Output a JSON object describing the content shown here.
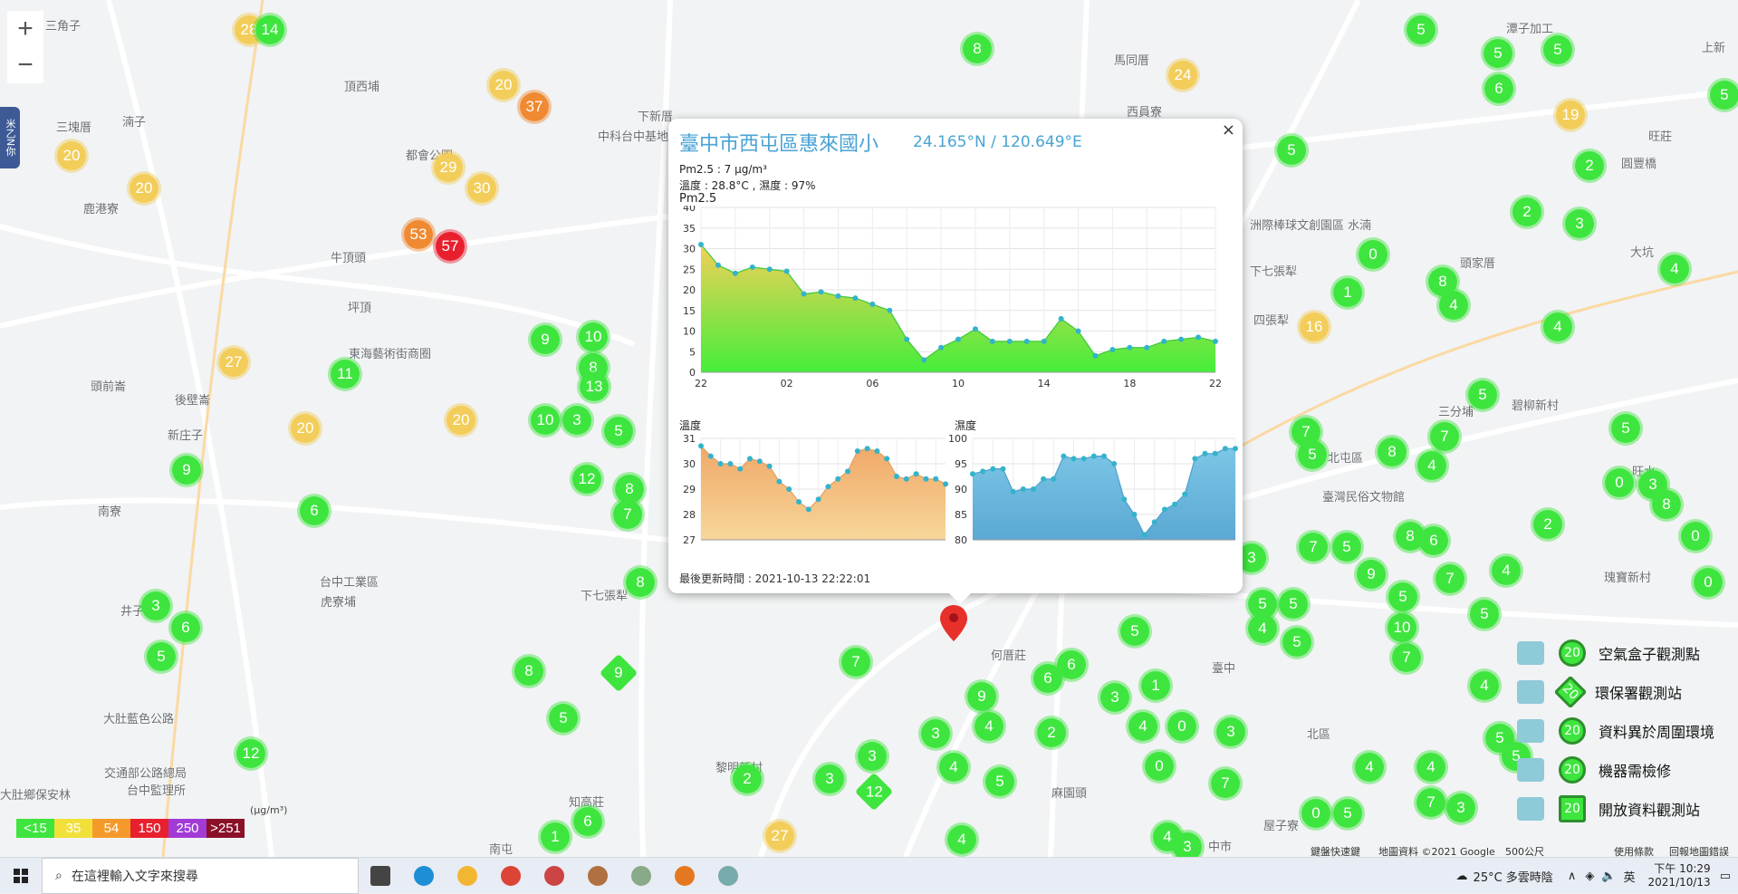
{
  "map": {
    "zoom_in": "+",
    "zoom_out": "−",
    "side_tab": "米乙N你",
    "place_labels": [
      {
        "text": "三角子",
        "x": 50,
        "y": 18
      },
      {
        "text": "湳子",
        "x": 135,
        "y": 124
      },
      {
        "text": "三塊厝",
        "x": 62,
        "y": 130
      },
      {
        "text": "鹿港寮",
        "x": 92,
        "y": 220
      },
      {
        "text": "頂西埔",
        "x": 380,
        "y": 85
      },
      {
        "text": "都會公園",
        "x": 448,
        "y": 161
      },
      {
        "text": "牛頂頭",
        "x": 365,
        "y": 274
      },
      {
        "text": "坪頂",
        "x": 384,
        "y": 329
      },
      {
        "text": "東海藝術街商圈",
        "x": 385,
        "y": 380
      },
      {
        "text": "頭前崙",
        "x": 100,
        "y": 416
      },
      {
        "text": "後壁崙",
        "x": 193,
        "y": 431
      },
      {
        "text": "新庄子",
        "x": 185,
        "y": 470
      },
      {
        "text": "南寮",
        "x": 108,
        "y": 554
      },
      {
        "text": "井子頭",
        "x": 133,
        "y": 664
      },
      {
        "text": "台中工業區",
        "x": 353,
        "y": 632
      },
      {
        "text": "虎寮埔",
        "x": 354,
        "y": 654
      },
      {
        "text": "大肚藍色公路",
        "x": 114,
        "y": 783
      },
      {
        "text": "交通部公路總局",
        "x": 115,
        "y": 843
      },
      {
        "text": "台中監理所",
        "x": 140,
        "y": 862
      },
      {
        "text": "大肚鄉保安林",
        "x": 0,
        "y": 867
      },
      {
        "text": "南屯",
        "x": 540,
        "y": 927
      },
      {
        "text": "知高莊",
        "x": 628,
        "y": 875
      },
      {
        "text": "下七張犁",
        "x": 641,
        "y": 647
      },
      {
        "text": "黎明新村",
        "x": 790,
        "y": 837
      },
      {
        "text": "何厝莊",
        "x": 1094,
        "y": 713
      },
      {
        "text": "麻園頭",
        "x": 1161,
        "y": 865
      },
      {
        "text": "臺中",
        "x": 1338,
        "y": 727
      },
      {
        "text": "北區",
        "x": 1443,
        "y": 800
      },
      {
        "text": "中市",
        "x": 1334,
        "y": 924
      },
      {
        "text": "屋子寮",
        "x": 1395,
        "y": 901
      },
      {
        "text": "洲際棒球文創園區 水湳",
        "x": 1380,
        "y": 238
      },
      {
        "text": "下七張犁",
        "x": 1380,
        "y": 289
      },
      {
        "text": "四張犁",
        "x": 1384,
        "y": 343
      },
      {
        "text": "北屯區",
        "x": 1466,
        "y": 495
      },
      {
        "text": "三分埔",
        "x": 1588,
        "y": 444
      },
      {
        "text": "臺灣民俗文物館",
        "x": 1460,
        "y": 538
      },
      {
        "text": "頭家厝",
        "x": 1612,
        "y": 280
      },
      {
        "text": "碧柳新村",
        "x": 1669,
        "y": 437
      },
      {
        "text": "大坑",
        "x": 1800,
        "y": 268
      },
      {
        "text": "旺水",
        "x": 1802,
        "y": 510
      },
      {
        "text": "瑰寶新村",
        "x": 1771,
        "y": 627
      },
      {
        "text": "上新",
        "x": 1879,
        "y": 42
      },
      {
        "text": "馬同厝",
        "x": 1230,
        "y": 56
      },
      {
        "text": "西員寮",
        "x": 1244,
        "y": 113
      },
      {
        "text": "下新厝",
        "x": 704,
        "y": 118
      },
      {
        "text": "中科台中基地",
        "x": 660,
        "y": 140
      },
      {
        "text": "潭子加工",
        "x": 1663,
        "y": 21
      },
      {
        "text": "旺莊",
        "x": 1820,
        "y": 140
      },
      {
        "text": "圓豐橋",
        "x": 1790,
        "y": 170
      }
    ],
    "markers": [
      {
        "v": "28",
        "c": "yellow",
        "x": 275,
        "y": 33
      },
      {
        "v": "14",
        "c": "green",
        "x": 298,
        "y": 33
      },
      {
        "v": "20",
        "c": "yellow",
        "x": 556,
        "y": 94
      },
      {
        "v": "37",
        "c": "orange",
        "x": 590,
        "y": 118
      },
      {
        "v": "20",
        "c": "yellow",
        "x": 79,
        "y": 172
      },
      {
        "v": "29",
        "c": "yellow",
        "x": 495,
        "y": 185
      },
      {
        "v": "30",
        "c": "yellow",
        "x": 532,
        "y": 208
      },
      {
        "v": "20",
        "c": "yellow",
        "x": 159,
        "y": 208
      },
      {
        "v": "53",
        "c": "orange",
        "x": 462,
        "y": 259
      },
      {
        "v": "57",
        "c": "red",
        "x": 497,
        "y": 272
      },
      {
        "v": "9",
        "c": "green",
        "x": 602,
        "y": 375
      },
      {
        "v": "10",
        "c": "green",
        "x": 655,
        "y": 372
      },
      {
        "v": "27",
        "c": "yellow",
        "x": 258,
        "y": 400
      },
      {
        "v": "11",
        "c": "green",
        "x": 381,
        "y": 413
      },
      {
        "v": "8",
        "c": "green",
        "x": 655,
        "y": 406
      },
      {
        "v": "13",
        "c": "green",
        "x": 656,
        "y": 427
      },
      {
        "v": "10",
        "c": "green",
        "x": 602,
        "y": 464
      },
      {
        "v": "3",
        "c": "green",
        "x": 637,
        "y": 464
      },
      {
        "v": "20",
        "c": "yellow",
        "x": 337,
        "y": 473
      },
      {
        "v": "20",
        "c": "yellow",
        "x": 509,
        "y": 464
      },
      {
        "v": "5",
        "c": "green",
        "x": 683,
        "y": 476
      },
      {
        "v": "9",
        "c": "green",
        "x": 206,
        "y": 519
      },
      {
        "v": "12",
        "c": "green",
        "x": 648,
        "y": 529
      },
      {
        "v": "8",
        "c": "green",
        "x": 695,
        "y": 540
      },
      {
        "v": "6",
        "c": "green",
        "x": 347,
        "y": 564
      },
      {
        "v": "7",
        "c": "green",
        "x": 693,
        "y": 568
      },
      {
        "v": "8",
        "c": "green",
        "x": 707,
        "y": 643
      },
      {
        "v": "3",
        "c": "green",
        "x": 172,
        "y": 669
      },
      {
        "v": "6",
        "c": "green",
        "x": 205,
        "y": 693
      },
      {
        "v": "5",
        "c": "green",
        "x": 178,
        "y": 725
      },
      {
        "v": "8",
        "c": "green",
        "x": 584,
        "y": 741
      },
      {
        "v": "5",
        "c": "green",
        "x": 622,
        "y": 793
      },
      {
        "v": "12",
        "c": "green",
        "x": 277,
        "y": 832
      },
      {
        "v": "1",
        "c": "green",
        "x": 613,
        "y": 924
      },
      {
        "v": "6",
        "c": "green",
        "x": 649,
        "y": 907
      },
      {
        "v": "27",
        "c": "yellow",
        "x": 861,
        "y": 923
      },
      {
        "v": "2",
        "c": "green",
        "x": 825,
        "y": 860
      },
      {
        "v": "3",
        "c": "green",
        "x": 916,
        "y": 860
      },
      {
        "v": "3",
        "c": "green",
        "x": 963,
        "y": 835
      },
      {
        "v": "7",
        "c": "green",
        "x": 945,
        "y": 731
      },
      {
        "v": "9",
        "c": "green",
        "x": 1084,
        "y": 769
      },
      {
        "v": "3",
        "c": "green",
        "x": 1033,
        "y": 810
      },
      {
        "v": "4",
        "c": "green",
        "x": 1092,
        "y": 802
      },
      {
        "v": "4",
        "c": "green",
        "x": 1053,
        "y": 847
      },
      {
        "v": "5",
        "c": "green",
        "x": 1104,
        "y": 863
      },
      {
        "v": "6",
        "c": "green",
        "x": 1157,
        "y": 749
      },
      {
        "v": "2",
        "c": "green",
        "x": 1161,
        "y": 809
      },
      {
        "v": "3",
        "c": "green",
        "x": 1231,
        "y": 770
      },
      {
        "v": "1",
        "c": "green",
        "x": 1276,
        "y": 757
      },
      {
        "v": "4",
        "c": "green",
        "x": 1262,
        "y": 802
      },
      {
        "v": "0",
        "c": "green",
        "x": 1305,
        "y": 802
      },
      {
        "v": "3",
        "c": "green",
        "x": 1359,
        "y": 808
      },
      {
        "v": "0",
        "c": "green",
        "x": 1280,
        "y": 846
      },
      {
        "v": "7",
        "c": "green",
        "x": 1353,
        "y": 865
      },
      {
        "v": "4",
        "c": "green",
        "x": 1289,
        "y": 924
      },
      {
        "v": "3",
        "c": "green",
        "x": 1311,
        "y": 935
      },
      {
        "v": "4",
        "c": "green",
        "x": 1062,
        "y": 927
      },
      {
        "v": "5",
        "c": "green",
        "x": 1253,
        "y": 697
      },
      {
        "v": "5",
        "c": "green",
        "x": 1394,
        "y": 667
      },
      {
        "v": "5",
        "c": "green",
        "x": 1428,
        "y": 667
      },
      {
        "v": "4",
        "c": "green",
        "x": 1394,
        "y": 694
      },
      {
        "v": "5",
        "c": "green",
        "x": 1432,
        "y": 709
      },
      {
        "v": "5",
        "c": "green",
        "x": 1549,
        "y": 659
      },
      {
        "v": "10",
        "c": "green",
        "x": 1548,
        "y": 693
      },
      {
        "v": "7",
        "c": "green",
        "x": 1553,
        "y": 726
      },
      {
        "v": "4",
        "c": "green",
        "x": 1639,
        "y": 757
      },
      {
        "v": "5",
        "c": "green",
        "x": 1656,
        "y": 815
      },
      {
        "v": "4",
        "c": "green",
        "x": 1512,
        "y": 847
      },
      {
        "v": "4",
        "c": "green",
        "x": 1580,
        "y": 847
      },
      {
        "v": "7",
        "c": "green",
        "x": 1580,
        "y": 886
      },
      {
        "v": "3",
        "c": "green",
        "x": 1613,
        "y": 892
      },
      {
        "v": "0",
        "c": "green",
        "x": 1453,
        "y": 898
      },
      {
        "v": "5",
        "c": "green",
        "x": 1488,
        "y": 898
      },
      {
        "v": "5",
        "c": "green",
        "x": 1674,
        "y": 835
      },
      {
        "v": "3",
        "c": "green",
        "x": 1382,
        "y": 616
      },
      {
        "v": "7",
        "c": "green",
        "x": 1450,
        "y": 604
      },
      {
        "v": "5",
        "c": "green",
        "x": 1487,
        "y": 604
      },
      {
        "v": "9",
        "c": "green",
        "x": 1514,
        "y": 634
      },
      {
        "v": "8",
        "c": "green",
        "x": 1557,
        "y": 592
      },
      {
        "v": "6",
        "c": "green",
        "x": 1583,
        "y": 597
      },
      {
        "v": "7",
        "c": "green",
        "x": 1601,
        "y": 639
      },
      {
        "v": "4",
        "c": "green",
        "x": 1663,
        "y": 630
      },
      {
        "v": "5",
        "c": "green",
        "x": 1639,
        "y": 678
      },
      {
        "v": "2",
        "c": "green",
        "x": 1709,
        "y": 579
      },
      {
        "v": "7",
        "c": "green",
        "x": 1442,
        "y": 477
      },
      {
        "v": "5",
        "c": "green",
        "x": 1449,
        "y": 502
      },
      {
        "v": "8",
        "c": "green",
        "x": 1537,
        "y": 499
      },
      {
        "v": "7",
        "c": "green",
        "x": 1595,
        "y": 482
      },
      {
        "v": "4",
        "c": "green",
        "x": 1581,
        "y": 514
      },
      {
        "v": "5",
        "c": "green",
        "x": 1637,
        "y": 436
      },
      {
        "v": "5",
        "c": "green",
        "x": 1795,
        "y": 473
      },
      {
        "v": "0",
        "c": "green",
        "x": 1788,
        "y": 533
      },
      {
        "v": "3",
        "c": "green",
        "x": 1825,
        "y": 535
      },
      {
        "v": "8",
        "c": "green",
        "x": 1840,
        "y": 557
      },
      {
        "v": "0",
        "c": "green",
        "x": 1872,
        "y": 592
      },
      {
        "v": "0",
        "c": "green",
        "x": 1886,
        "y": 643
      },
      {
        "v": "16",
        "c": "yellow",
        "x": 1451,
        "y": 361
      },
      {
        "v": "1",
        "c": "green",
        "x": 1488,
        "y": 323
      },
      {
        "v": "8",
        "c": "green",
        "x": 1593,
        "y": 311
      },
      {
        "v": "4",
        "c": "green",
        "x": 1605,
        "y": 337
      },
      {
        "v": "0",
        "c": "green",
        "x": 1516,
        "y": 281
      },
      {
        "v": "2",
        "c": "green",
        "x": 1686,
        "y": 234
      },
      {
        "v": "3",
        "c": "green",
        "x": 1744,
        "y": 247
      },
      {
        "v": "4",
        "c": "green",
        "x": 1720,
        "y": 361
      },
      {
        "v": "4",
        "c": "green",
        "x": 1849,
        "y": 297
      },
      {
        "v": "5",
        "c": "green",
        "x": 1426,
        "y": 166
      },
      {
        "v": "19",
        "c": "yellow",
        "x": 1734,
        "y": 127
      },
      {
        "v": "2",
        "c": "green",
        "x": 1755,
        "y": 183
      },
      {
        "v": "5",
        "c": "green",
        "x": 1654,
        "y": 59
      },
      {
        "v": "6",
        "c": "green",
        "x": 1655,
        "y": 98
      },
      {
        "v": "5",
        "c": "green",
        "x": 1720,
        "y": 55
      },
      {
        "v": "5",
        "c": "green",
        "x": 1569,
        "y": 33
      },
      {
        "v": "5",
        "c": "green",
        "x": 1904,
        "y": 105
      },
      {
        "v": "8",
        "c": "green",
        "x": 1079,
        "y": 54
      },
      {
        "v": "24",
        "c": "yellow",
        "x": 1306,
        "y": 83
      },
      {
        "v": "6",
        "c": "green",
        "x": 1183,
        "y": 734
      }
    ],
    "diamonds": [
      {
        "v": "9",
        "x": 683,
        "y": 743
      },
      {
        "v": "12",
        "x": 965,
        "y": 874
      }
    ],
    "copyright": {
      "shortcut": "鍵盤快速鍵",
      "data": "地圖資料 ©2021 Google",
      "scale": "500公尺",
      "terms": "使用條款",
      "report": "回報地圖錯誤"
    }
  },
  "popup": {
    "title": "臺中市西屯區惠來國小",
    "coords": "24.165°N / 120.649°E",
    "close": "×",
    "pm25_line": "Pm2.5 : 7 μg/m³",
    "weather_line": "溫度 : 28.8°C , 濕度 : 97%",
    "chart_label": "Pm2.5",
    "temp_label": "溫度",
    "humid_label": "濕度",
    "updated": "最後更新時間 : 2021-10-13 22:22:01"
  },
  "chart_data": [
    {
      "type": "area",
      "title": "Pm2.5",
      "x_ticks": [
        "22",
        "02",
        "06",
        "10",
        "14",
        "18",
        "22"
      ],
      "ylim": [
        0,
        40
      ],
      "y_ticks": [
        0,
        5,
        10,
        15,
        20,
        25,
        30,
        35,
        40
      ],
      "grid": true,
      "values": [
        31,
        26,
        24,
        25.5,
        25,
        24.5,
        19,
        19.5,
        18.5,
        18,
        16.5,
        15,
        8,
        3,
        6,
        8,
        10.5,
        7.5,
        7.5,
        7.5,
        7.5,
        13,
        10,
        4,
        5.5,
        6,
        6,
        7.5,
        8,
        8.5,
        7.5
      ]
    },
    {
      "type": "area",
      "title": "溫度",
      "ylim": [
        27,
        31
      ],
      "y_ticks": [
        27,
        28,
        29,
        30,
        31
      ],
      "grid": true,
      "values": [
        30.7,
        30.3,
        30.0,
        30.0,
        29.8,
        30.2,
        30.1,
        29.9,
        29.3,
        29.0,
        28.5,
        28.2,
        28.6,
        29.1,
        29.4,
        29.7,
        30.5,
        30.6,
        30.5,
        30.2,
        29.5,
        29.4,
        29.6,
        29.4,
        29.4,
        29.2
      ]
    },
    {
      "type": "area",
      "title": "濕度",
      "ylim": [
        80,
        100
      ],
      "y_ticks": [
        80,
        85,
        90,
        95,
        100
      ],
      "grid": true,
      "values": [
        93,
        93.5,
        94,
        94,
        89.5,
        90,
        90,
        92,
        92,
        96.5,
        96,
        96,
        96.5,
        96.5,
        95,
        88,
        85,
        81,
        83.5,
        86,
        87,
        89,
        96,
        97,
        97,
        98,
        98
      ]
    }
  ],
  "legend": {
    "unit": "(μg/m³)",
    "levels": [
      {
        "label": "<15",
        "color": "#3ee53e"
      },
      {
        "label": "35",
        "color": "#f2e03a"
      },
      {
        "label": "54",
        "color": "#f59a2a"
      },
      {
        "label": "150",
        "color": "#e8202e"
      },
      {
        "label": "250",
        "color": "#a23bd6"
      },
      {
        "label": ">251",
        "color": "#8a1028"
      }
    ],
    "types": [
      {
        "label": "空氣盒子觀測點",
        "icon": "airbox-icon",
        "value": "20"
      },
      {
        "label": "環保署觀測站",
        "icon": "epa-building-icon",
        "value": "20"
      },
      {
        "label": "資料異於周圍環境",
        "icon": "anomaly-house-icon",
        "value": "20"
      },
      {
        "label": "機器需檢修",
        "icon": "repair-icon",
        "value": "20"
      },
      {
        "label": "開放資料觀測站",
        "icon": "opendata-icon",
        "value": "20"
      }
    ]
  },
  "taskbar": {
    "search_placeholder": "在這裡輸入文字來搜尋",
    "weather": "25°C 多雲時陰",
    "ime": "英",
    "time": "下午 10:29",
    "date": "2021/10/13",
    "apps": [
      "task-view-icon",
      "edge-icon",
      "file-explorer-icon",
      "chrome-icon",
      "app-icon-1",
      "app-icon-2",
      "app-icon-3",
      "app-icon-4",
      "app-icon-5"
    ]
  }
}
